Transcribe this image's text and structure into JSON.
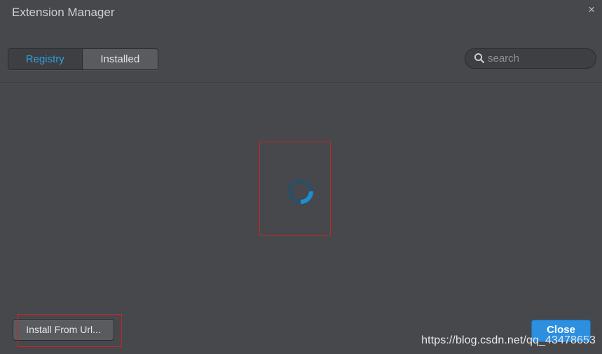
{
  "dialog": {
    "title": "Extension Manager",
    "close_glyph": "×"
  },
  "tabs": [
    {
      "label": "Registry",
      "active": true
    },
    {
      "label": "Installed",
      "active": false
    }
  ],
  "search": {
    "placeholder": "search",
    "value": "",
    "icon": "search-icon"
  },
  "content": {
    "state": "loading",
    "spinner_color": "#1b8fd6",
    "spinner_track_color": "#2f4d63"
  },
  "footer": {
    "install_label": "Install From Url...",
    "close_label": "Close"
  },
  "watermark": "https://blog.csdn.net/qq_43478653",
  "colors": {
    "background": "#47484b",
    "accent": "#2c8fe0",
    "active_tab_text": "#2d9ee0",
    "annotation_red": "#c4262b"
  }
}
